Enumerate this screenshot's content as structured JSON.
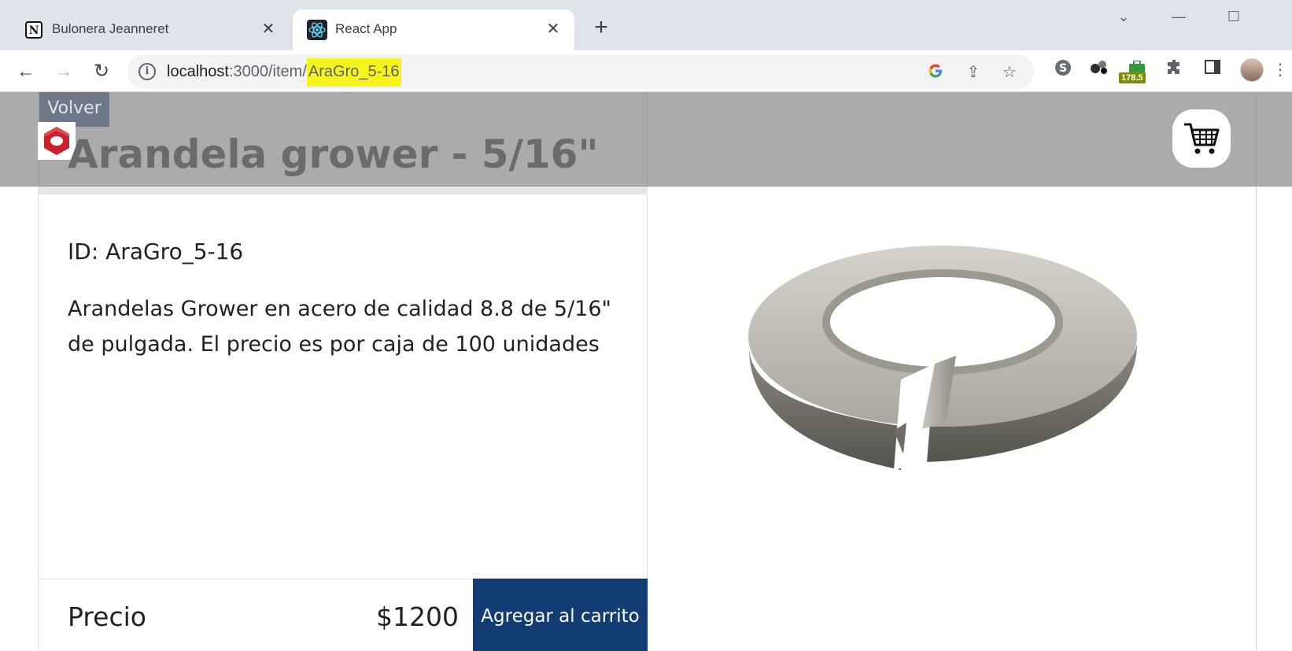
{
  "browser": {
    "tabs": [
      {
        "title": "Bulonera Jeanneret",
        "favicon": "notion-icon",
        "active": false
      },
      {
        "title": "React App",
        "favicon": "react-icon",
        "active": true
      }
    ],
    "url": {
      "host": "localhost",
      "path": ":3000/item/",
      "highlight": "AraGro_5-16"
    },
    "extension_badge": "178.5"
  },
  "page": {
    "back_label": "Volver",
    "title": "Arandela grower - 5/16\"",
    "id_line": "ID: AraGro_5-16",
    "description": "Arandelas Grower en acero de calidad 8.8 de 5/16\" de pulgada. El precio es por caja de 100 unidades",
    "price_label": "Precio",
    "price_value": "$1200",
    "add_button": "Agregar al carrito",
    "colors": {
      "accent": "#123c74",
      "back_button": "#6f7888",
      "overlay": "#6e6e6e"
    }
  }
}
